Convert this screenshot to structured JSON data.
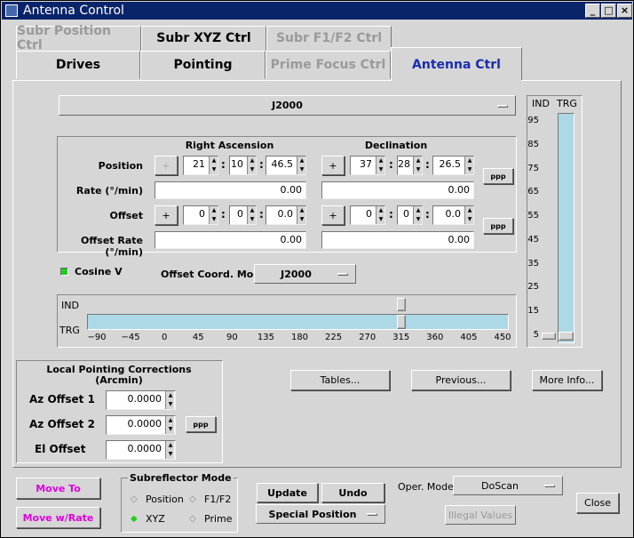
{
  "window": {
    "title": "Antenna Control",
    "buttons": [
      "_",
      "□",
      "×"
    ]
  },
  "tabs": {
    "row1": [
      "Subr Position Ctrl",
      "Subr XYZ Ctrl",
      "Subr F1/F2 Ctrl"
    ],
    "row2": [
      "Drives",
      "Pointing",
      "Prime Focus Ctrl",
      "Antenna Ctrl"
    ]
  },
  "epoch": "J2000",
  "coords": {
    "ra_header": "Right Ascension",
    "dec_header": "Declination",
    "position_label": "Position",
    "rate_label": "Rate (°/min)",
    "offset_label": "Offset",
    "offset_rate_label": "Offset Rate (°/min)",
    "ra_pos": {
      "sign": "+",
      "h": "21",
      "m": "10",
      "s": "46.5"
    },
    "dec_pos": {
      "sign": "+",
      "d": "37",
      "m": "28",
      "s": "26.5"
    },
    "ra_rate": "0.00",
    "dec_rate": "0.00",
    "ra_off": {
      "sign": "+",
      "h": "0",
      "m": "0",
      "s": "0.0"
    },
    "dec_off": {
      "sign": "+",
      "d": "0",
      "m": "0",
      "s": "0.0"
    },
    "ra_off_rate": "0.00",
    "dec_off_rate": "0.00",
    "ellipsis": "ppp"
  },
  "cosine_v": "Cosine V",
  "offset_mode": {
    "label": "Offset Coord. Mode",
    "value": "J2000"
  },
  "az_slider": {
    "ind_label": "IND",
    "trg_label": "TRG",
    "ticks": [
      "−90",
      "−45",
      "0",
      "45",
      "90",
      "135",
      "180",
      "225",
      "270",
      "315",
      "360",
      "405",
      "450"
    ],
    "ind_value": 315,
    "trg_value": 315
  },
  "el_slider": {
    "ind_label": "IND",
    "trg_label": "TRG",
    "ticks": [
      "95",
      "85",
      "75",
      "65",
      "55",
      "45",
      "35",
      "25",
      "15",
      "5"
    ],
    "ind_value": 5,
    "trg_value": 5
  },
  "lpc": {
    "title": "Local Pointing Corrections",
    "subtitle": "(Arcmin)",
    "az1_label": "Az Offset 1",
    "az1": "0.0000",
    "az2_label": "Az Offset 2",
    "az2": "0.0000",
    "el_label": "El Offset",
    "el": "0.0000",
    "ellipsis": "ppp"
  },
  "actions": {
    "tables": "Tables...",
    "previous": "Previous...",
    "more": "More Info..."
  },
  "bottom": {
    "move_to": "Move To",
    "move_rate": "Move w/Rate",
    "sub_mode_title": "Subreflector Mode",
    "sub_position": "Position",
    "sub_f1f2": "F1/F2",
    "sub_xyz": "XYZ",
    "sub_prime": "Prime",
    "update": "Update",
    "undo": "Undo",
    "special": "Special Position",
    "oper_label": "Oper. Mode:",
    "oper_value": "DoScan",
    "illegal": "Illegal Values",
    "close": "Close"
  },
  "colors": {
    "title_bar": "#0a246a",
    "slider_fill": "#add8e6",
    "move": "#e000e0",
    "active_tab": "#1a2db0",
    "led": "#22cc22"
  }
}
